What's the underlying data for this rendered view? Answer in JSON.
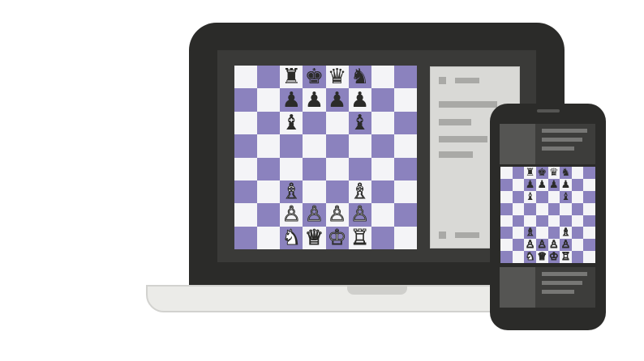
{
  "colors": {
    "device_frame": "#2b2b29",
    "screen_bezel": "#3a3a38",
    "board_light": "#f4f4f7",
    "board_dark": "#8b82be",
    "panel": "#d9d9d6",
    "panel_bar": "#a9a9a6",
    "laptop_base": "#ebebe8"
  },
  "board": {
    "ranks": [
      [
        "",
        "",
        "♜",
        "♚",
        "♛",
        "♞",
        "",
        ""
      ],
      [
        "",
        "",
        "♟",
        "♟",
        "♟",
        "♟",
        "",
        ""
      ],
      [
        "",
        "",
        "♝",
        "",
        "",
        "♝",
        "",
        ""
      ],
      [
        "",
        "",
        "",
        "",
        "",
        "",
        "",
        ""
      ],
      [
        "",
        "",
        "",
        "",
        "",
        "",
        "",
        ""
      ],
      [
        "",
        "",
        "♗",
        "",
        "",
        "♗",
        "",
        ""
      ],
      [
        "",
        "",
        "♙",
        "♙",
        "♙",
        "♙",
        "",
        ""
      ],
      [
        "",
        "",
        "♞",
        "♕",
        "♔",
        "♖",
        "",
        ""
      ]
    ],
    "white_pieces": [
      "♔",
      "♕",
      "♖",
      "♗",
      "♘",
      "♙"
    ],
    "black_on_white_row": "♞"
  },
  "icons": {
    "laptop": "laptop-icon",
    "phone": "smartphone-icon"
  }
}
